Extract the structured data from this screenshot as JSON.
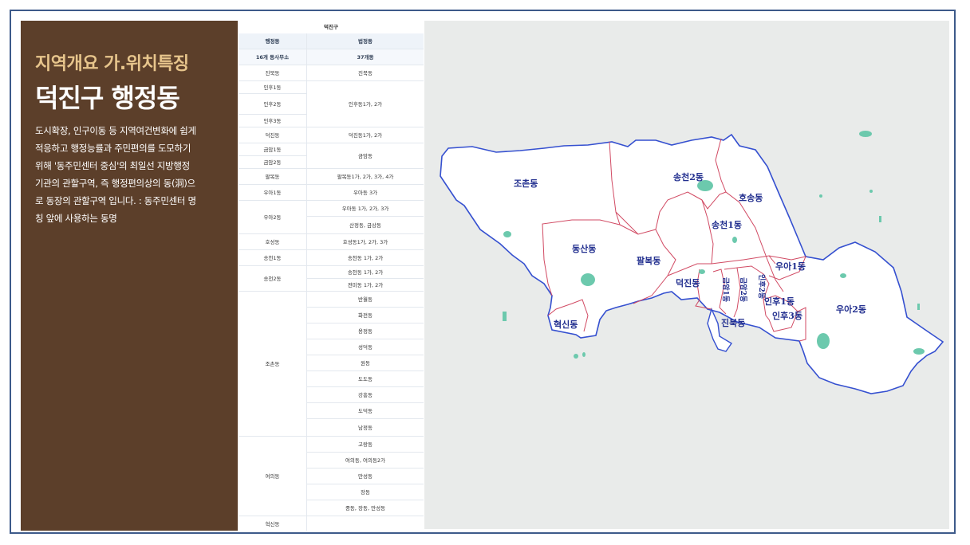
{
  "panel": {
    "title_line1": "지역개요 가.위치특징",
    "title_line2": "덕진구 행정동",
    "description_lines": [
      "도시확장, 인구이동 등 지역여건변화에 쉽게",
      "적응하고 행정능률과 주민편의를 도모하기",
      "위해 '동주민센터 중심'의 최일선 지방행정",
      "기관의 관할구역, 즉 행정편의상의 동(洞)으",
      "로 동장의 관할구역 입니다. : 동주민센터 명",
      "칭 앞에 사용하는 동명"
    ]
  },
  "table": {
    "caption": "덕진구",
    "headers": [
      "행정동",
      "법정동"
    ],
    "subheaders": [
      "16개 동사무소",
      "37개동"
    ],
    "left_cells": [
      "진북동",
      "인후1동",
      "인후2동",
      "인후3동",
      "덕진동",
      "금암1동",
      "금암2동",
      "팔복동",
      "우아1동",
      "우아2동",
      "호성동",
      "송천1동",
      "송천2동",
      "조촌동",
      "여의동",
      "혁신동"
    ],
    "right_cells": [
      "진북동",
      "인후동1가, 2가",
      "덕진동1가, 2가",
      "금암동",
      "팔복동1가, 2가, 3가, 4가",
      "우아동 3가",
      "우아동 1가, 2가, 3가",
      "산정동, 금상동",
      "호성동1가, 2가, 3가",
      "송천동 1가, 2가",
      "송천동 1가, 2가",
      "전미동 1가, 2가",
      "반월동",
      "화전동",
      "용정동",
      "성덕동",
      "원동",
      "도도동",
      "강흥동",
      "도덕동",
      "남정동",
      "고랑동",
      "여의동, 여의동2가",
      "만성동",
      "장동",
      "중동, 장동, 만성동"
    ]
  },
  "map": {
    "labels": {
      "jochon": "조촌동",
      "songcheon2": "송천2동",
      "hoseong": "호송동",
      "songcheon1": "송천1동",
      "dongsan": "동산동",
      "palbok": "팔복동",
      "ua1": "우아1동",
      "deokjin": "덕진동",
      "geumam1": "금암1동",
      "geumam2": "금암2동",
      "inhu2": "인후2동",
      "inhu1": "인후1동",
      "inhu3": "인후3동",
      "jinbuk": "진북동",
      "hyeoksin": "혁신동",
      "ua2": "우아2동"
    },
    "colors": {
      "boundary": "#3550d0",
      "inner_boundary": "#d14a63",
      "water": "#6cc9ad",
      "land": "#ffffff",
      "sea": "#e9ebea"
    }
  }
}
